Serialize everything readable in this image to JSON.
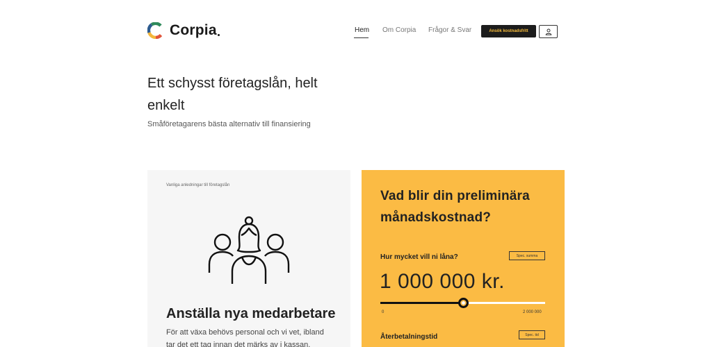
{
  "brand": {
    "name": "Corpia",
    "colors": {
      "accent": "#fbbb44",
      "dark": "#1c1c1c",
      "logo_green": "#2f8a5b",
      "logo_yellow": "#f3b73b",
      "logo_red": "#e0543a",
      "logo_blue": "#2d5b8f"
    }
  },
  "nav": {
    "items": [
      {
        "label": "Hem",
        "active": true
      },
      {
        "label": "Om Corpia",
        "active": false
      },
      {
        "label": "Frågor & Svar",
        "active": false
      }
    ],
    "cta_label": "Ansök kostnadsfritt",
    "user_icon": "user-icon"
  },
  "hero": {
    "title": "Ett schysst företagslån, helt enkelt",
    "subtitle": "Småföretagarens bästa alternativ till finansiering"
  },
  "reason_card": {
    "label": "Vanliga anledningar till företagslån",
    "icon": "people-group-icon",
    "title": "Anställa nya medarbetare",
    "text": "För att växa behövs personal och vi vet, ibland tar det ett tag innan det märks av i kassan."
  },
  "calculator": {
    "title": "Vad blir din preliminära månadskostnad?",
    "amount_label": "Hur mycket vill ni låna?",
    "amount_spec_label": "Spec. summa",
    "amount_value": "1 000 000 kr.",
    "slider_fraction": 0.5,
    "slider_min": "0",
    "slider_max": "2 000 000",
    "term_label": "Återbetalningstid",
    "term_spec_label": "Spec. tid"
  }
}
